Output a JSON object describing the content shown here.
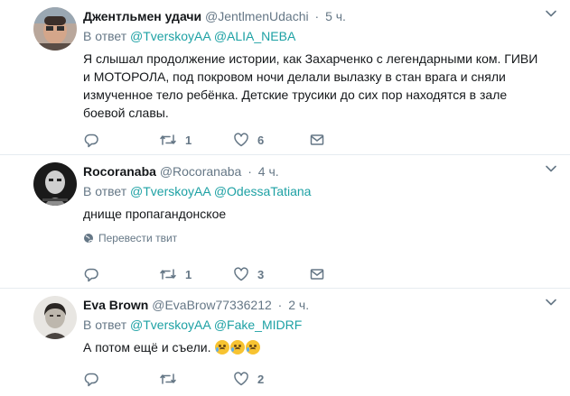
{
  "tweets": [
    {
      "fullname": "Джентльмен удачи",
      "username": "@JentlmenUdachi",
      "dot": "·",
      "time": "5 ч.",
      "reply_prefix": "В ответ",
      "mentions": [
        "@TverskoyAA",
        "@ALIA_NEBA"
      ],
      "text": "Я слышал продолжение истории, как Захарченко с легендарными ком. ГИВИ и МОТОРОЛА, под покровом ночи делали вылазку в стан врага и сняли измученное тело ребёнка. Детские трусики до сих пор находятся в зале боевой славы.",
      "retweets": "1",
      "likes": "6"
    },
    {
      "fullname": "Rocoranaba",
      "username": "@Rocoranaba",
      "dot": "·",
      "time": "4 ч.",
      "reply_prefix": "В ответ",
      "mentions": [
        "@TverskoyAA",
        "@OdessaTatiana"
      ],
      "text": "днище пропагандонское",
      "translate": "Перевести твит",
      "retweets": "1",
      "likes": "3"
    },
    {
      "fullname": "Eva Brown",
      "username": "@EvaBrow77336212",
      "dot": "·",
      "time": "2 ч.",
      "reply_prefix": "В ответ",
      "mentions": [
        "@TverskoyAA",
        "@Fake_MIDRF"
      ],
      "text": "А потом ещё и съели.",
      "retweets": "",
      "likes": "2"
    }
  ],
  "icons": {
    "reply": "reply-icon",
    "retweet": "retweet-icon",
    "like": "heart-icon",
    "dm": "envelope-icon",
    "caret": "chevron-down-icon",
    "globe": "globe-icon",
    "emoji": "crying-face-icon"
  },
  "colors": {
    "link": "#1da1a4",
    "muted": "#657786",
    "text": "#14171a",
    "divider": "#e6ecf0"
  }
}
